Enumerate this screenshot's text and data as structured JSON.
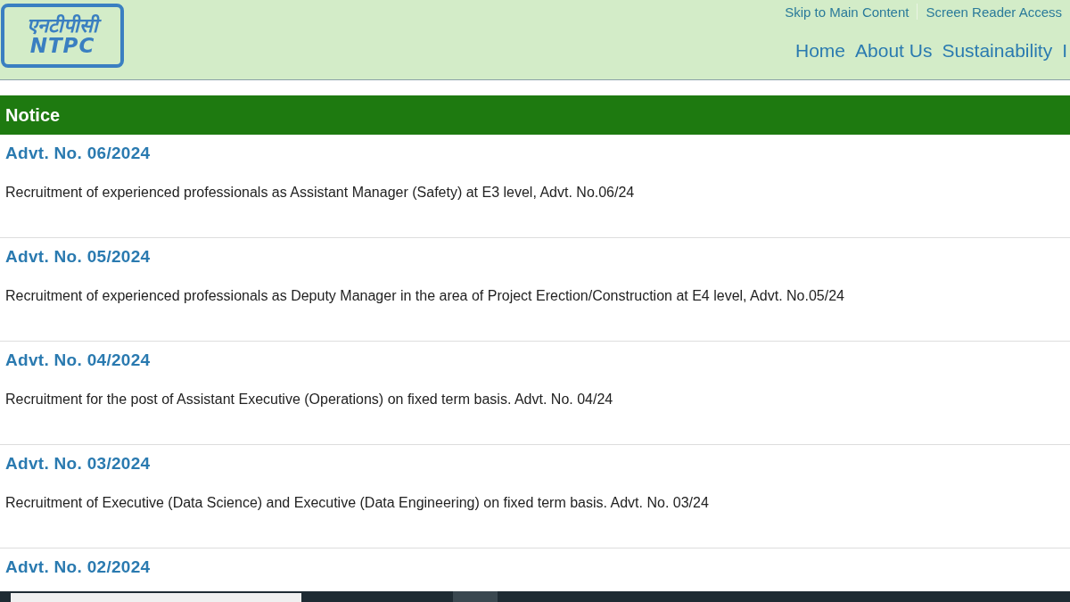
{
  "logo": {
    "hindi": "एनटीपीसी",
    "english": "NTPC"
  },
  "utility_links": [
    "Skip to Main Content",
    "Screen Reader Access"
  ],
  "nav": [
    "Home",
    "About Us",
    "Sustainability",
    "I"
  ],
  "notice": {
    "heading": "Notice",
    "items": [
      {
        "title": "Advt. No. 06/2024",
        "description": "Recruitment of experienced professionals as Assistant Manager (Safety) at E3 level, Advt. No.06/24"
      },
      {
        "title": "Advt. No. 05/2024",
        "description": "Recruitment of experienced professionals as Deputy Manager in the area of Project Erection/Construction at E4 level, Advt. No.05/24"
      },
      {
        "title": "Advt. No. 04/2024",
        "description": "Recruitment for the post of Assistant Executive (Operations) on fixed term basis. Advt. No. 04/24"
      },
      {
        "title": "Advt. No. 03/2024",
        "description": "Recruitment of Executive (Data Science) and Executive (Data Engineering) on fixed term basis. Advt. No. 03/24"
      },
      {
        "title": "Advt. No. 02/2024"
      }
    ]
  }
}
